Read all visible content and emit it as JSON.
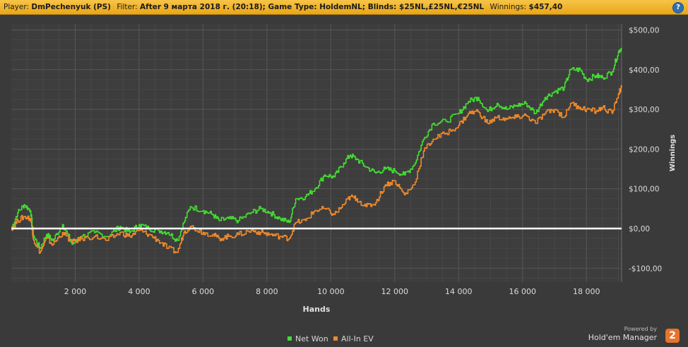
{
  "header": {
    "player_label": "Player:",
    "player_value": "DmPechenyuk (PS)",
    "filter_label": "Filter:",
    "filter_value": "After 9 марта 2018 г. (20:18); Game Type: HoldemNL; Blinds: $25NL,£25NL,€25NL",
    "winnings_label": "Winnings:",
    "winnings_value": "$457,40",
    "help_glyph": "?"
  },
  "chart_data": {
    "type": "line",
    "xlabel": "Hands",
    "ylabel": "Winnings",
    "xlim": [
      0,
      19100
    ],
    "ylim": [
      -135,
      515
    ],
    "x_ticks": [
      2000,
      4000,
      6000,
      8000,
      10000,
      12000,
      14000,
      16000,
      18000
    ],
    "x_tick_labels": [
      "2 000",
      "4 000",
      "6 000",
      "8 000",
      "10 000",
      "12 000",
      "14 000",
      "16 000",
      "18 000"
    ],
    "y_ticks": [
      500,
      400,
      300,
      200,
      100,
      0,
      -100
    ],
    "y_tick_labels": [
      "$500,00",
      "$400,00",
      "$300,00",
      "$200,00",
      "$100,00",
      "$0,00",
      "-$100,00"
    ],
    "grid": true,
    "zero_line_color": "#ffffff",
    "legend_position": "bottom-center",
    "series": [
      {
        "name": "Net Won",
        "color": "#44dd33",
        "points": [
          [
            0,
            0
          ],
          [
            200,
            40
          ],
          [
            400,
            60
          ],
          [
            600,
            45
          ],
          [
            700,
            -20
          ],
          [
            900,
            -50
          ],
          [
            1100,
            -15
          ],
          [
            1300,
            -30
          ],
          [
            1600,
            10
          ],
          [
            1900,
            -40
          ],
          [
            2200,
            -20
          ],
          [
            2600,
            -10
          ],
          [
            3000,
            -20
          ],
          [
            3400,
            5
          ],
          [
            3700,
            -10
          ],
          [
            4000,
            10
          ],
          [
            4300,
            0
          ],
          [
            4600,
            -5
          ],
          [
            4900,
            -10
          ],
          [
            5200,
            -30
          ],
          [
            5400,
            15
          ],
          [
            5600,
            55
          ],
          [
            6000,
            45
          ],
          [
            6300,
            35
          ],
          [
            6500,
            20
          ],
          [
            6800,
            25
          ],
          [
            7100,
            20
          ],
          [
            7500,
            40
          ],
          [
            7800,
            50
          ],
          [
            8100,
            40
          ],
          [
            8400,
            25
          ],
          [
            8700,
            15
          ],
          [
            8900,
            75
          ],
          [
            9200,
            80
          ],
          [
            9500,
            100
          ],
          [
            9800,
            135
          ],
          [
            10100,
            130
          ],
          [
            10400,
            165
          ],
          [
            10600,
            185
          ],
          [
            10800,
            175
          ],
          [
            11100,
            155
          ],
          [
            11400,
            140
          ],
          [
            11700,
            150
          ],
          [
            12000,
            145
          ],
          [
            12300,
            135
          ],
          [
            12600,
            160
          ],
          [
            12900,
            225
          ],
          [
            13200,
            265
          ],
          [
            13600,
            270
          ],
          [
            14000,
            290
          ],
          [
            14300,
            320
          ],
          [
            14600,
            330
          ],
          [
            14900,
            295
          ],
          [
            15200,
            315
          ],
          [
            15500,
            300
          ],
          [
            15800,
            310
          ],
          [
            16100,
            315
          ],
          [
            16400,
            290
          ],
          [
            16700,
            330
          ],
          [
            17000,
            345
          ],
          [
            17300,
            355
          ],
          [
            17500,
            400
          ],
          [
            17800,
            400
          ],
          [
            18000,
            375
          ],
          [
            18300,
            385
          ],
          [
            18500,
            380
          ],
          [
            18800,
            395
          ],
          [
            19000,
            445
          ],
          [
            19100,
            455
          ]
        ]
      },
      {
        "name": "All-In EV",
        "color": "#f08a2c",
        "points": [
          [
            0,
            0
          ],
          [
            200,
            20
          ],
          [
            400,
            30
          ],
          [
            600,
            25
          ],
          [
            700,
            -30
          ],
          [
            900,
            -60
          ],
          [
            1100,
            -25
          ],
          [
            1300,
            -40
          ],
          [
            1600,
            -10
          ],
          [
            1900,
            -35
          ],
          [
            2200,
            -25
          ],
          [
            2600,
            -20
          ],
          [
            3000,
            -30
          ],
          [
            3400,
            -10
          ],
          [
            3700,
            -20
          ],
          [
            4000,
            -5
          ],
          [
            4300,
            -15
          ],
          [
            4600,
            -30
          ],
          [
            4900,
            -50
          ],
          [
            5200,
            -60
          ],
          [
            5400,
            -10
          ],
          [
            5600,
            5
          ],
          [
            6000,
            -10
          ],
          [
            6300,
            -15
          ],
          [
            6500,
            -25
          ],
          [
            6800,
            -20
          ],
          [
            7100,
            -15
          ],
          [
            7500,
            -5
          ],
          [
            7800,
            -10
          ],
          [
            8100,
            -15
          ],
          [
            8400,
            -20
          ],
          [
            8700,
            -25
          ],
          [
            8900,
            15
          ],
          [
            9200,
            20
          ],
          [
            9500,
            45
          ],
          [
            9800,
            50
          ],
          [
            10100,
            35
          ],
          [
            10400,
            60
          ],
          [
            10600,
            80
          ],
          [
            10800,
            75
          ],
          [
            11100,
            55
          ],
          [
            11400,
            65
          ],
          [
            11700,
            110
          ],
          [
            12000,
            120
          ],
          [
            12300,
            85
          ],
          [
            12600,
            110
          ],
          [
            12900,
            195
          ],
          [
            13200,
            225
          ],
          [
            13600,
            240
          ],
          [
            14000,
            260
          ],
          [
            14300,
            290
          ],
          [
            14600,
            295
          ],
          [
            14900,
            265
          ],
          [
            15200,
            280
          ],
          [
            15500,
            275
          ],
          [
            15800,
            280
          ],
          [
            16100,
            285
          ],
          [
            16400,
            265
          ],
          [
            16700,
            290
          ],
          [
            17000,
            300
          ],
          [
            17300,
            280
          ],
          [
            17500,
            315
          ],
          [
            17800,
            305
          ],
          [
            18000,
            300
          ],
          [
            18300,
            295
          ],
          [
            18500,
            305
          ],
          [
            18800,
            290
          ],
          [
            19000,
            340
          ],
          [
            19100,
            355
          ]
        ]
      }
    ]
  },
  "branding": {
    "powered_by": "Powered by",
    "product": "Hold'em Manager",
    "logo_glyph": "2"
  }
}
